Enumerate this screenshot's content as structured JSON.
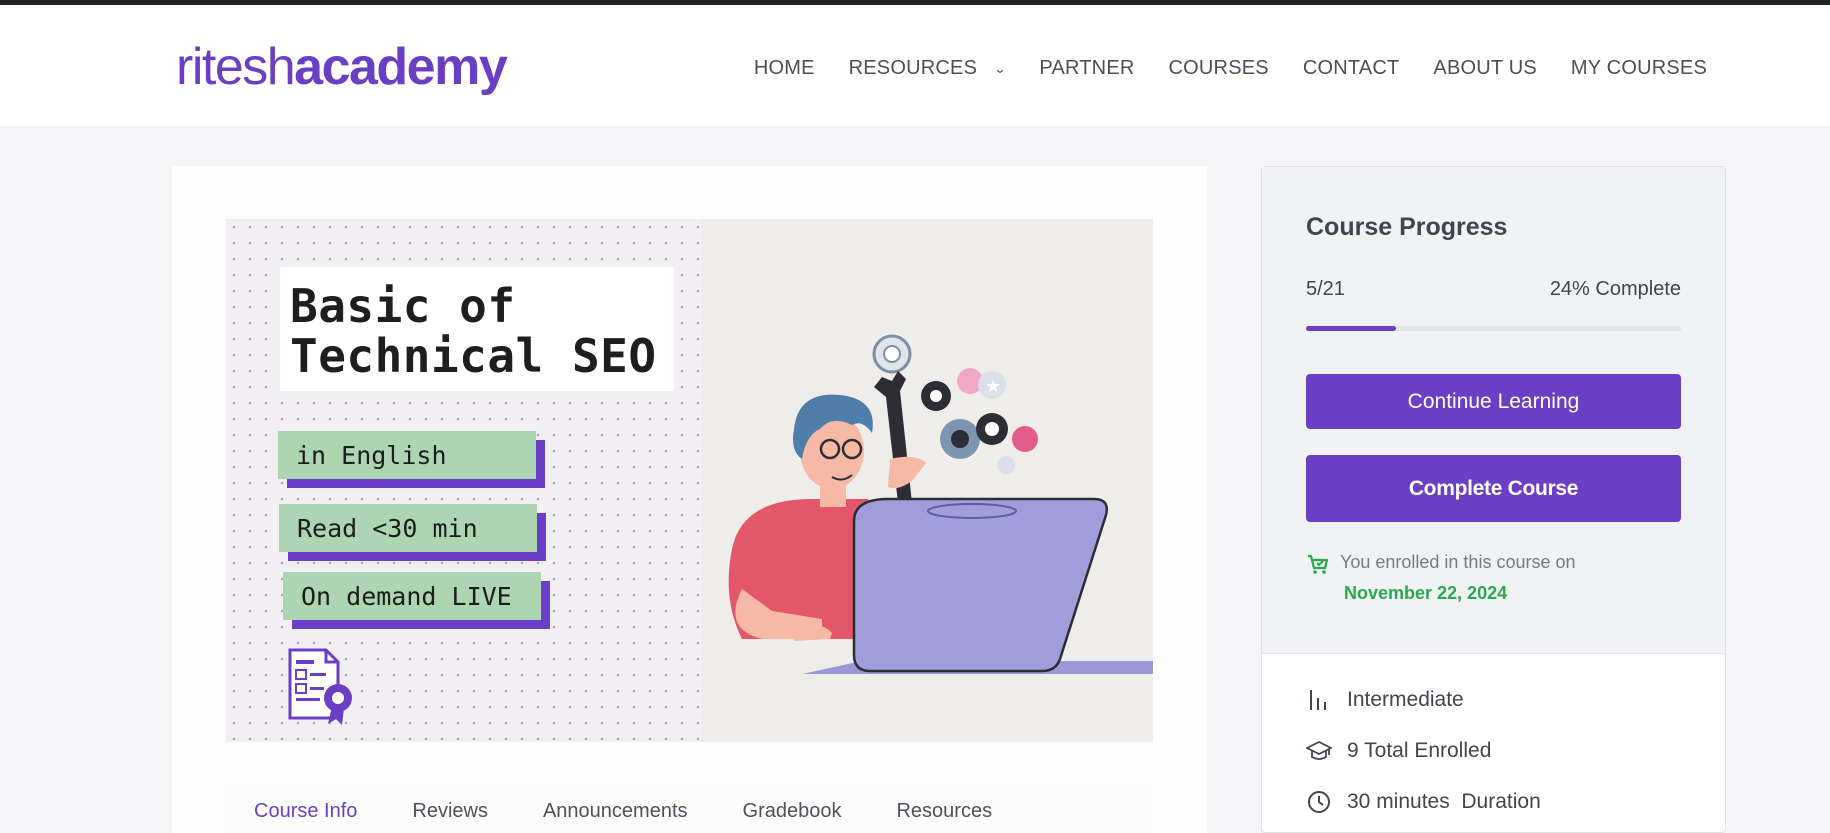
{
  "header": {
    "logo_thin": "ritesh",
    "logo_bold": "academy",
    "nav": [
      {
        "label": "HOME"
      },
      {
        "label": "RESOURCES",
        "dropdown": true
      },
      {
        "label": "PARTNER"
      },
      {
        "label": "COURSES"
      },
      {
        "label": "CONTACT"
      },
      {
        "label": "ABOUT US"
      },
      {
        "label": "MY COURSES"
      }
    ]
  },
  "thumbnail": {
    "title_line1": "Basic of",
    "title_line2": "Technical SEO",
    "tags": [
      "in English",
      "Read <30 min",
      "On demand LIVE"
    ]
  },
  "tabs": [
    "Course Info",
    "Reviews",
    "Announcements",
    "Gradebook",
    "Resources"
  ],
  "sidebar": {
    "progress_title": "Course Progress",
    "progress_count": "5/21",
    "progress_percent_label": "24% Complete",
    "progress_fraction": 0.24,
    "continue_label": "Continue Learning",
    "complete_label": "Complete Course",
    "enrolled_text": "You enrolled in this course on",
    "enrolled_date": "November 22, 2024",
    "meta": [
      {
        "icon": "level-bars-icon",
        "text": "Intermediate"
      },
      {
        "icon": "graduation-cap-icon",
        "text": "9 Total Enrolled"
      },
      {
        "icon": "clock-icon",
        "text": "30 minutes  Duration"
      }
    ]
  },
  "colors": {
    "brand": "#6b3fc4",
    "success": "#2aa84d",
    "tag_green": "#aed5b2"
  }
}
